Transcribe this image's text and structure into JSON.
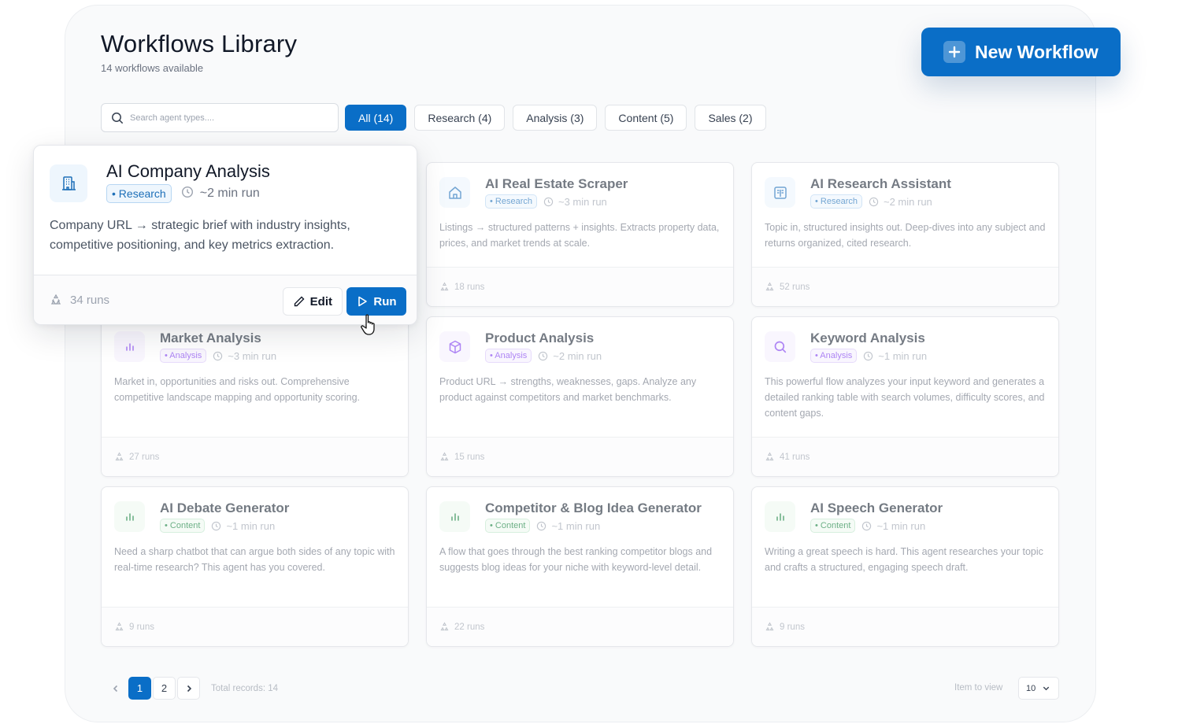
{
  "header": {
    "title": "Workflows Library",
    "subtitle": "14 workflows available",
    "new_button": "New Workflow"
  },
  "search": {
    "placeholder": "Search agent types...."
  },
  "filters": [
    {
      "label": "All (14)",
      "active": true
    },
    {
      "label": "Research (4)",
      "active": false
    },
    {
      "label": "Analysis (3)",
      "active": false
    },
    {
      "label": "Content (5)",
      "active": false
    },
    {
      "label": "Sales (2)",
      "active": false
    }
  ],
  "featured": {
    "name": "AI Company Analysis",
    "tag": "• Research",
    "duration": "~2 min run",
    "description": "Company URL → strategic brief with industry insights, competitive positioning, and key metrics extraction.",
    "runs": "34 runs",
    "edit_label": "Edit",
    "run_label": "Run",
    "icon": "building-icon"
  },
  "cards": [
    {
      "name": "AI Real Estate Scraper",
      "tag": "• Research",
      "duration": "~3 min run",
      "description": "Listings → structured patterns + insights. Extracts property data, prices, and market trends at scale.",
      "runs": "18 runs",
      "icon": "home-icon"
    },
    {
      "name": "AI Research Assistant",
      "tag": "• Research",
      "duration": "~2 min run",
      "description": "Topic in, structured insights out. Deep-dives into any subject and returns organized, cited research.",
      "runs": "52 runs",
      "icon": "book-icon"
    },
    {
      "name": "Market Analysis",
      "tag": "• Analysis",
      "duration": "~3 min run",
      "description": "Market in, opportunities and risks out. Comprehensive competitive landscape mapping and opportunity scoring.",
      "runs": "27 runs",
      "icon": "bar-chart-icon"
    },
    {
      "name": "Product Analysis",
      "tag": "• Analysis",
      "duration": "~2 min run",
      "description": "Product URL → strengths, weaknesses, gaps. Analyze any product against competitors and market benchmarks.",
      "runs": "15 runs",
      "icon": "box-icon"
    },
    {
      "name": "Keyword Analysis",
      "tag": "• Analysis",
      "duration": "~1 min run",
      "description": "This powerful flow analyzes your input keyword and generates a detailed ranking table with search volumes, difficulty scores, and content gaps.",
      "runs": "41 runs",
      "icon": "search-icon"
    },
    {
      "name": "AI Debate Generator",
      "tag": "• Content",
      "duration": "~1 min run",
      "description": "Need a sharp chatbot that can argue both sides of any topic with real-time research? This agent has you covered.",
      "runs": "9 runs",
      "icon": "bar-chart-icon"
    },
    {
      "name": "Competitor & Blog Idea Generator",
      "tag": "• Content",
      "duration": "~1 min run",
      "description": "A flow that goes through the best ranking competitor blogs and suggests blog ideas for your niche with keyword-level detail.",
      "runs": "22 runs",
      "icon": "bar-chart-icon"
    },
    {
      "name": "AI Speech Generator",
      "tag": "• Content",
      "duration": "~1 min run",
      "description": "Writing a great speech is hard. This agent researches your topic and crafts a structured, engaging speech draft.",
      "runs": "9 runs",
      "icon": "bar-chart-icon"
    }
  ],
  "pagination": {
    "pages": [
      "1",
      "2"
    ],
    "current": "1",
    "total": "Total records: 14",
    "view_label": "Item to view",
    "view_value": "10"
  },
  "colors": {
    "accent": "#0a6ec7",
    "research": "#1d6fb8",
    "analysis": "#7c3aed",
    "content": "#15803d"
  }
}
